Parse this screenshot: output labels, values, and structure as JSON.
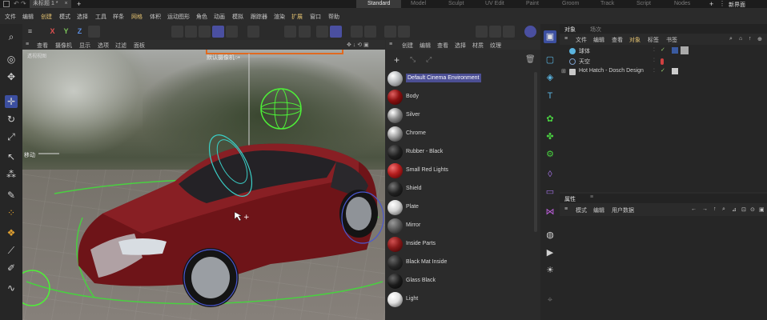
{
  "titlebar": {
    "doc_tab": "未标题 1 *",
    "layouts": [
      "Standard",
      "Model",
      "Sculpt",
      "UV Edit",
      "Paint",
      "Groom",
      "Track",
      "Script",
      "Nodes"
    ],
    "active_layout": "Standard",
    "new_layout": "新界面"
  },
  "menu": {
    "items": [
      "文件",
      "编辑",
      "创建",
      "模式",
      "选择",
      "工具",
      "样条",
      "网格",
      "体积",
      "运动图形",
      "角色",
      "动画",
      "模拟",
      "跟踪器",
      "渲染",
      "扩展",
      "窗口",
      "帮助"
    ],
    "highlight_index": 2
  },
  "toolbar": {
    "axes": [
      {
        "label": "X",
        "color": "#e05050"
      },
      {
        "label": "Y",
        "color": "#7bc45a"
      },
      {
        "label": "Z",
        "color": "#5a8ce0"
      }
    ]
  },
  "viewport": {
    "menu": [
      "查看",
      "摄像机",
      "显示",
      "选项",
      "过滤",
      "面板"
    ],
    "view_name": "透视视图",
    "camera_label": "默认摄像机",
    "camera_suffix": "○•",
    "move_label": "移动",
    "accent": "#4c4f94"
  },
  "materials": {
    "menu": [
      "创建",
      "编辑",
      "查看",
      "选择",
      "材质",
      "纹理"
    ],
    "items": [
      {
        "name": "Default Cinema Environment",
        "swatch": "#b9bcbf",
        "selected": true
      },
      {
        "name": "Body",
        "swatch": "#8a1010"
      },
      {
        "name": "Silver",
        "swatch": "#8c8c8c"
      },
      {
        "name": "Chrome",
        "swatch": "#a8a8a8"
      },
      {
        "name": "Rubber - Black",
        "swatch": "#1e1e1e"
      },
      {
        "name": "Small Red Lights",
        "swatch": "#b41e1e"
      },
      {
        "name": "Shield",
        "swatch": "#202020"
      },
      {
        "name": "Plate",
        "swatch": "#d2d2d2"
      },
      {
        "name": "Mirror",
        "swatch": "#5c5c5c"
      },
      {
        "name": "Inside Parts",
        "swatch": "#8a1a1a"
      },
      {
        "name": "Black Mat Inside",
        "swatch": "#262626"
      },
      {
        "name": "Glass Black",
        "swatch": "#1a1a1a"
      },
      {
        "name": "Light",
        "swatch": "#e0e0e0"
      }
    ]
  },
  "objects": {
    "tabs": [
      "对象",
      "场次"
    ],
    "active_tab": 0,
    "menu": [
      "文件",
      "编辑",
      "查看",
      "对象",
      "标签",
      "书签"
    ],
    "active_menu": 3,
    "rows": [
      {
        "name": "球体",
        "icon_color": "#5ab4e0",
        "indent": 1
      },
      {
        "name": "天空",
        "icon_color": "#7a9cc8",
        "indent": 1
      },
      {
        "name": "Hot Hatch - Dosch Design",
        "icon_color": "#c8c8c8",
        "indent": 0
      }
    ]
  },
  "attributes": {
    "tab": "属性",
    "menu": [
      "模式",
      "编辑",
      "用户数据"
    ]
  }
}
